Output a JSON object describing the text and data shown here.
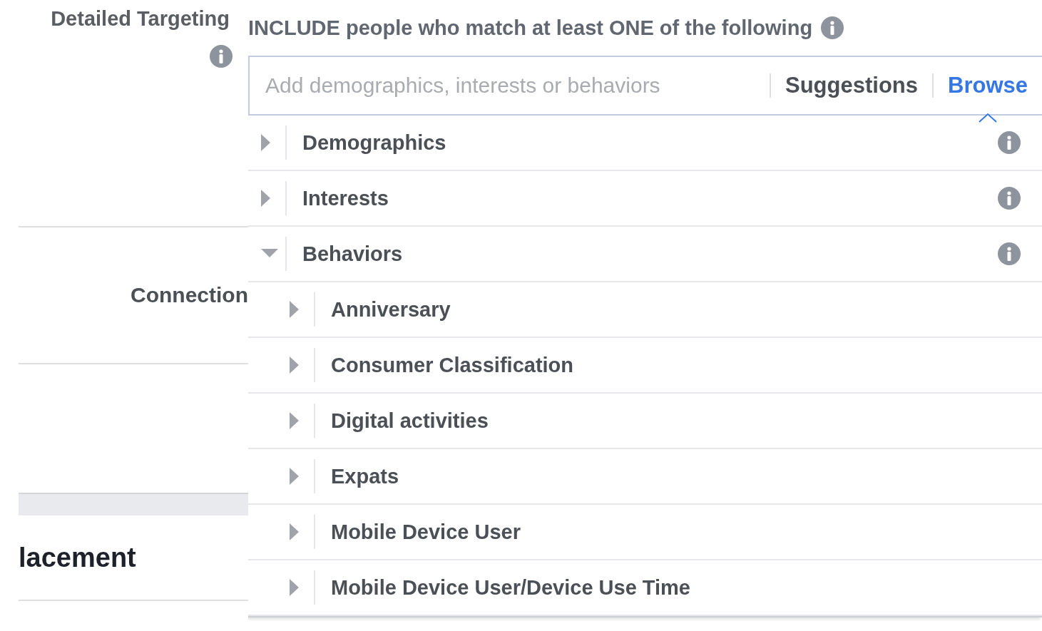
{
  "left": {
    "label": "Detailed Targeting",
    "sections": [
      {
        "title": "Connection",
        "kind": "label"
      },
      {
        "title": "lacement",
        "kind": "heading"
      }
    ]
  },
  "targeting": {
    "include_text": "INCLUDE people who match at least ONE of the following",
    "placeholder": "Add demographics, interests or behaviors",
    "tabs": [
      {
        "label": "Suggestions",
        "selected": false
      },
      {
        "label": "Browse",
        "selected": true
      }
    ],
    "categories": [
      {
        "label": "Demographics",
        "expanded": false
      },
      {
        "label": "Interests",
        "expanded": false
      },
      {
        "label": "Behaviors",
        "expanded": true,
        "children": [
          {
            "label": "Anniversary",
            "expanded": false
          },
          {
            "label": "Consumer Classification",
            "expanded": false
          },
          {
            "label": "Digital activities",
            "expanded": false
          },
          {
            "label": "Expats",
            "expanded": false
          },
          {
            "label": "Mobile Device User",
            "expanded": false
          },
          {
            "label": "Mobile Device User/Device Use Time",
            "expanded": false
          }
        ]
      }
    ]
  }
}
